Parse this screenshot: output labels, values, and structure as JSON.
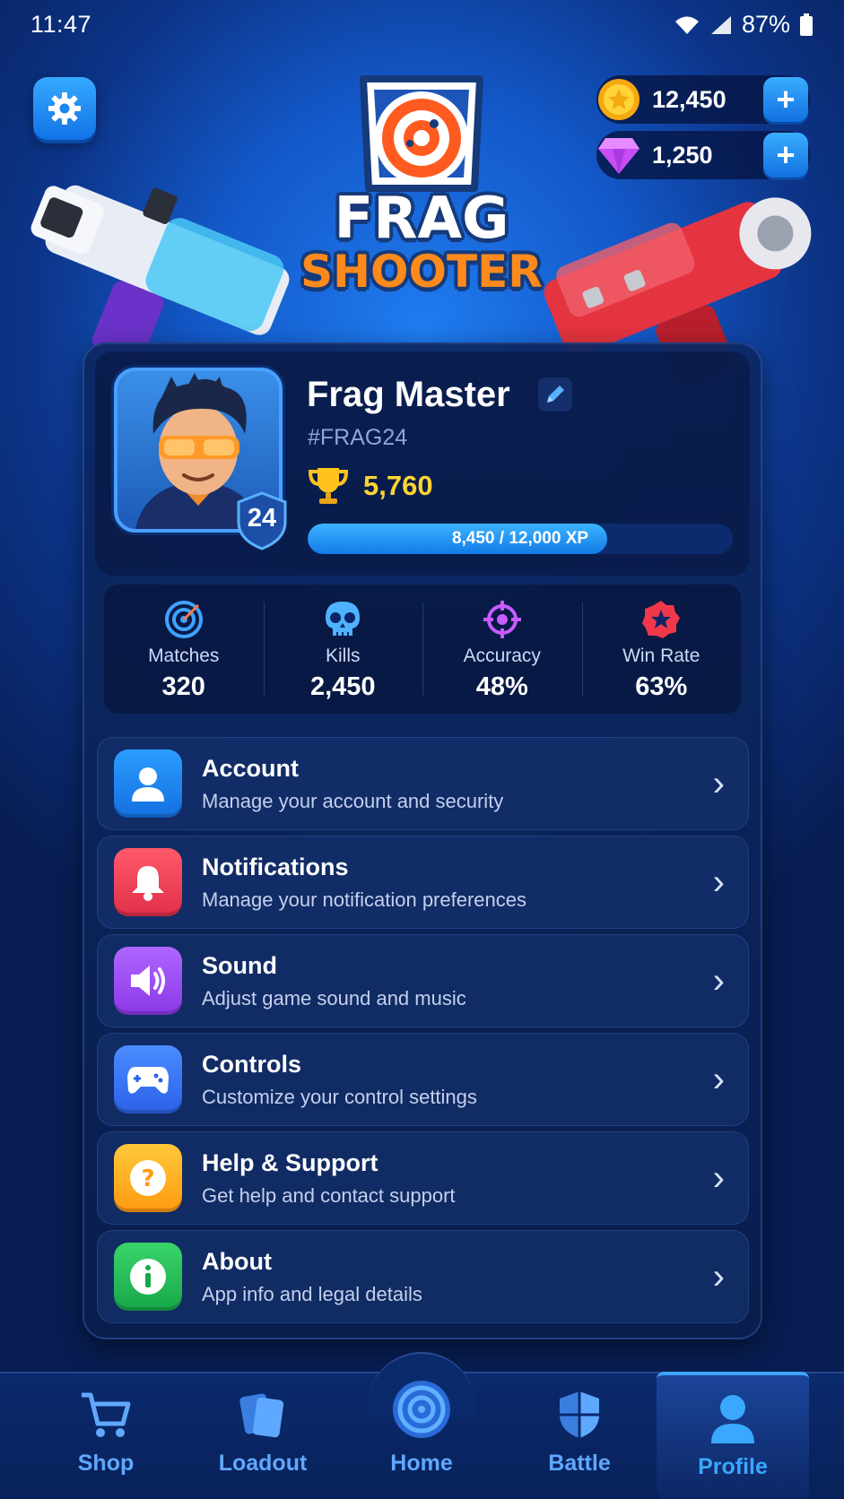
{
  "status_bar": {
    "time": "11:47",
    "battery": "87%"
  },
  "currencies": {
    "coins": {
      "value": "12,450",
      "icon": "coin-icon"
    },
    "gems": {
      "value": "1,250",
      "icon": "gem-icon"
    }
  },
  "logo": {
    "line1": "FRAG",
    "line2": "SHOOTER"
  },
  "profile": {
    "name": "Frag Master",
    "tag": "#FRAG24",
    "level": "24",
    "trophies": "5,760",
    "xp_text": "8,450 / 12,000 XP",
    "xp_progress": 0.704
  },
  "stats": [
    {
      "label": "Matches",
      "value": "320",
      "icon": "target-icon"
    },
    {
      "label": "Kills",
      "value": "2,450",
      "icon": "skull-icon"
    },
    {
      "label": "Accuracy",
      "value": "48%",
      "icon": "crosshair-icon"
    },
    {
      "label": "Win Rate",
      "value": "63%",
      "icon": "star-badge-icon"
    }
  ],
  "menu": [
    {
      "title": "Account",
      "subtitle": "Manage your account and security",
      "icon": "user-icon",
      "color": "#1e88f5"
    },
    {
      "title": "Notifications",
      "subtitle": "Manage your notification preferences",
      "icon": "bell-icon",
      "color": "#f0465a"
    },
    {
      "title": "Sound",
      "subtitle": "Adjust game sound and music",
      "icon": "speaker-icon",
      "color": "#9b4cf0"
    },
    {
      "title": "Controls",
      "subtitle": "Customize your control settings",
      "icon": "gamepad-icon",
      "color": "#3b7cf5"
    },
    {
      "title": "Help & Support",
      "subtitle": "Get help and contact support",
      "icon": "question-icon",
      "color": "#ffb01f"
    },
    {
      "title": "About",
      "subtitle": "App info and legal details",
      "icon": "info-icon",
      "color": "#22c05a"
    }
  ],
  "nav": [
    {
      "label": "Shop",
      "icon": "cart-icon"
    },
    {
      "label": "Loadout",
      "icon": "cards-icon"
    },
    {
      "label": "Home",
      "icon": "target-home-icon"
    },
    {
      "label": "Battle",
      "icon": "shield-icon"
    },
    {
      "label": "Profile",
      "icon": "profile-icon",
      "active": true
    }
  ]
}
